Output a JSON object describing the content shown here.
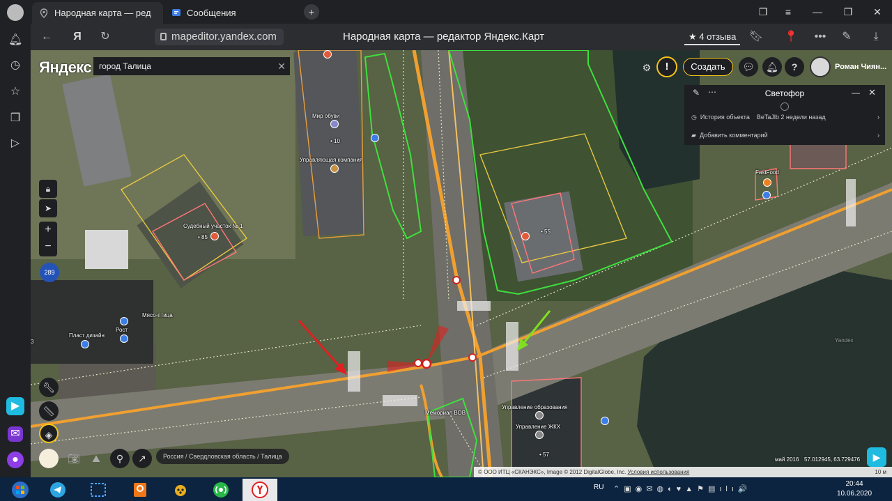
{
  "browser": {
    "tabs": [
      {
        "label": "Народная карта — ред",
        "active": true
      },
      {
        "label": "Сообщения",
        "active": false
      }
    ],
    "url": "mapeditor.yandex.com",
    "page_title": "Народная карта — редактор Яндекс.Карт",
    "reviews": "★ 4 отзыва",
    "back_icon": "arrow-left-icon",
    "yandex_letter": "Я"
  },
  "map": {
    "logo": "Яндекс",
    "search_value": "город Талица",
    "create_label": "Создать",
    "user_name": "Роман Чиян...",
    "zoom_plus": "+",
    "zoom_minus": "−",
    "counter_badge": "289",
    "help_label": "?",
    "warn_label": "!",
    "breadcrumb": "Россия / Свердловская область / Талица",
    "copyright": "© ООО ИТЦ «СКАНЭКС», Image © 2012 DigitalGlobe, Inc.",
    "terms_link": "Условия использования",
    "imagery_date": "май 2016",
    "coordinates": "57.012945, 63.729476",
    "scale": "10 м",
    "watermark": "Yandex",
    "labels": {
      "court": "Судебный участок № 1",
      "court_num": "• 85",
      "shoes": "Мир обуви",
      "shoes_num": "• 10",
      "mgmt": "Управляющая компания",
      "num55": "• 55",
      "fastfood": "FastFood",
      "meat": "Мясо-птица",
      "rost": "Рост",
      "plast": "Пласт дизайн",
      "edu": "Управление образования",
      "zhkh": "Управление ЖКХ",
      "num57": "• 57",
      "memorial": "Мемориал ВОВ",
      "b3": "3"
    }
  },
  "panel": {
    "title": "Светофор",
    "history_label": "История объекта",
    "history_user": "BeTaJlb",
    "history_time": "2 недели назад",
    "comment_label": "Добавить комментарий"
  },
  "taskbar": {
    "lang": "RU",
    "time": "20:44",
    "date": "10.06.2020"
  },
  "colors": {
    "accent": "#f5c518",
    "road": "#f0a030",
    "arrow_red": "#e02020",
    "arrow_green": "#7fe020"
  }
}
